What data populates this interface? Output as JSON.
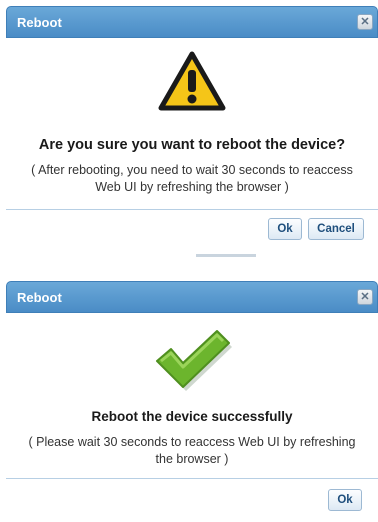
{
  "dialog_confirm": {
    "title": "Reboot",
    "close_symbol": "✕",
    "icon": "warning-icon",
    "heading": "Are you sure you want to reboot the device?",
    "note": "( After rebooting, you need to wait 30 seconds to reaccess Web UI by refreshing the browser )",
    "ok_label": "Ok",
    "cancel_label": "Cancel"
  },
  "dialog_success": {
    "title": "Reboot",
    "close_symbol": "✕",
    "icon": "checkmark-icon",
    "heading": "Reboot the device successfully",
    "note": "( Please wait 30 seconds to reaccess Web UI by refreshing the browser )",
    "ok_label": "Ok"
  },
  "colors": {
    "titlebar": "#4a8cc6",
    "warning": "#f5c518",
    "success": "#6cb52d"
  }
}
